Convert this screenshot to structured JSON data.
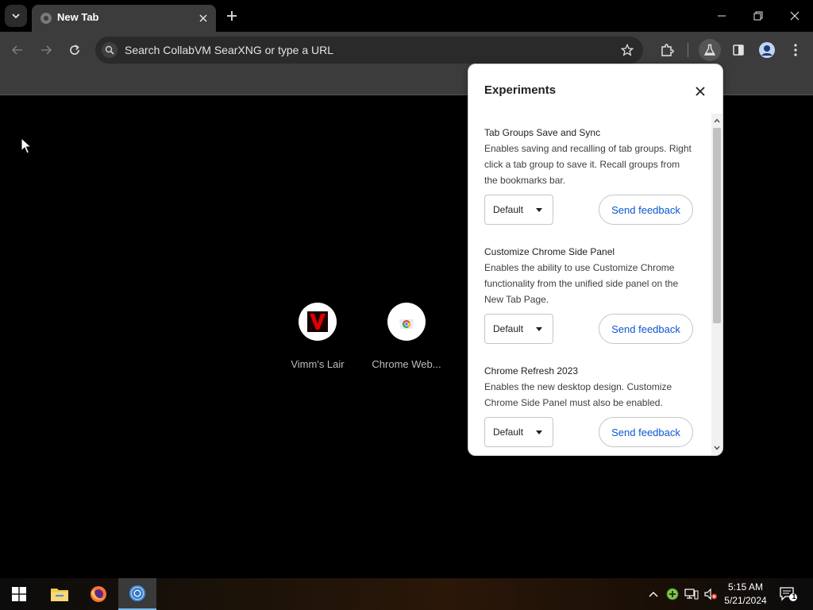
{
  "browser": {
    "tab_title": "New Tab",
    "omnibox_placeholder": "Search CollabVM SearXNG or type a URL"
  },
  "shortcuts": [
    {
      "label": "Vimm's Lair",
      "icon": "vimms-lair-icon"
    },
    {
      "label": "Chrome Web...",
      "icon": "chrome-web-store-icon"
    }
  ],
  "experiments": {
    "title": "Experiments",
    "items": [
      {
        "name": "Tab Groups Save and Sync",
        "description": "Enables saving and recalling of tab groups. Right click a tab group to save it. Recall groups from the bookmarks bar.",
        "selected": "Default",
        "feedback_label": "Send feedback"
      },
      {
        "name": "Customize Chrome Side Panel",
        "description": "Enables the ability to use Customize Chrome functionality from the unified side panel on the New Tab Page.",
        "selected": "Default",
        "feedback_label": "Send feedback"
      },
      {
        "name": "Chrome Refresh 2023",
        "description": "Enables the new desktop design. Customize Chrome Side Panel must also be enabled.",
        "selected": "Default",
        "feedback_label": "Send feedback"
      }
    ]
  },
  "taskbar": {
    "time": "5:15 AM",
    "date": "5/21/2024",
    "notification_count": "1"
  },
  "colors": {
    "accent_blue": "#0b57d0",
    "taskbar_active": "#76b9ed"
  }
}
